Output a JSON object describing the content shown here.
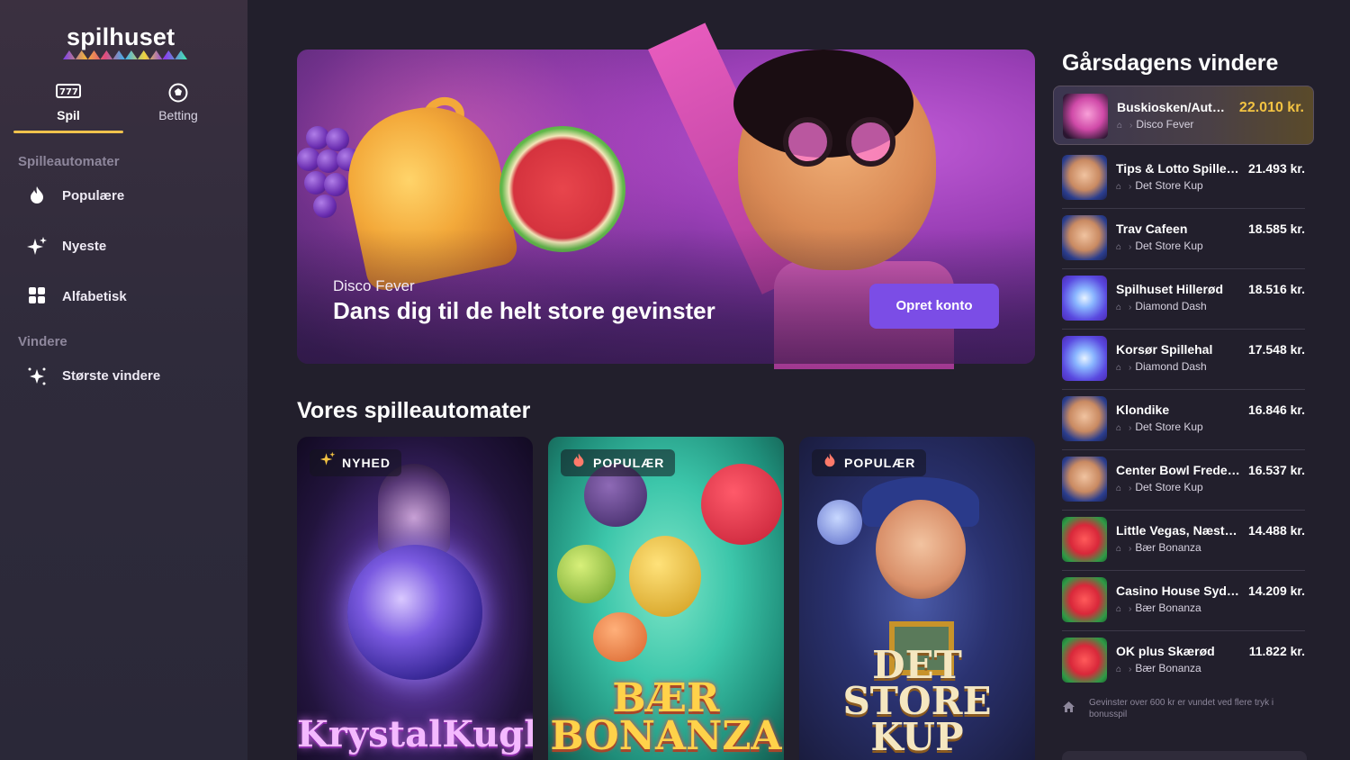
{
  "brand": {
    "name": "spilhuset"
  },
  "tabs": [
    {
      "label": "Spil",
      "icon": "slot-machine-icon",
      "active": true
    },
    {
      "label": "Betting",
      "icon": "football-icon",
      "active": false
    }
  ],
  "sidebar": {
    "section1_title": "Spilleautomater",
    "items": [
      {
        "label": "Populære",
        "icon": "flame-icon"
      },
      {
        "label": "Nyeste",
        "icon": "sparkle-icon"
      },
      {
        "label": "Alfabetisk",
        "icon": "grid-icon"
      }
    ],
    "section2_title": "Vindere",
    "winner_items": [
      {
        "label": "Største vindere",
        "icon": "star-burst-icon"
      }
    ]
  },
  "hero": {
    "subtitle": "Disco Fever",
    "title": "Dans dig til de helt store gevinster",
    "button_label": "Opret konto"
  },
  "games": {
    "title": "Vores spilleautomater",
    "cards": [
      {
        "badge": "NYHED",
        "badge_icon": "sparkle-icon",
        "name": "KrystalKuglen"
      },
      {
        "badge": "POPULÆR",
        "badge_icon": "flame-icon",
        "name": "BÆR BONANZA"
      },
      {
        "badge": "POPULÆR",
        "badge_icon": "flame-icon",
        "name": "DET STORE KUP"
      }
    ]
  },
  "winners": {
    "title": "Gårsdagens vindere",
    "list": [
      {
        "name": "Buskiosken/Automatcaféen",
        "game": "Disco Fever",
        "amount": "22.010 kr.",
        "avatar": "disco"
      },
      {
        "name": "Tips & Lotto Spillehal",
        "game": "Det Store Kup",
        "amount": "21.493 kr.",
        "avatar": "thief"
      },
      {
        "name": "Trav Cafeen",
        "game": "Det Store Kup",
        "amount": "18.585 kr.",
        "avatar": "thief"
      },
      {
        "name": "Spilhuset Hillerød",
        "game": "Diamond Dash",
        "amount": "18.516 kr.",
        "avatar": "diamond"
      },
      {
        "name": "Korsør Spillehal",
        "game": "Diamond Dash",
        "amount": "17.548 kr.",
        "avatar": "diamond"
      },
      {
        "name": "Klondike",
        "game": "Det Store Kup",
        "amount": "16.846 kr.",
        "avatar": "thief"
      },
      {
        "name": "Center Bowl Frederikssund",
        "game": "Det Store Kup",
        "amount": "16.537 kr.",
        "avatar": "thief"
      },
      {
        "name": "Little Vegas, Næstved",
        "game": "Bær Bonanza",
        "amount": "14.488 kr.",
        "avatar": "berry"
      },
      {
        "name": "Casino House Sydhavnen",
        "game": "Bær Bonanza",
        "amount": "14.209 kr.",
        "avatar": "berry"
      },
      {
        "name": "OK plus Skærød",
        "game": "Bær Bonanza",
        "amount": "11.822 kr.",
        "avatar": "berry"
      }
    ],
    "note": "Gevinster over 600 kr er vundet ved flere tryk i bonusspil"
  }
}
